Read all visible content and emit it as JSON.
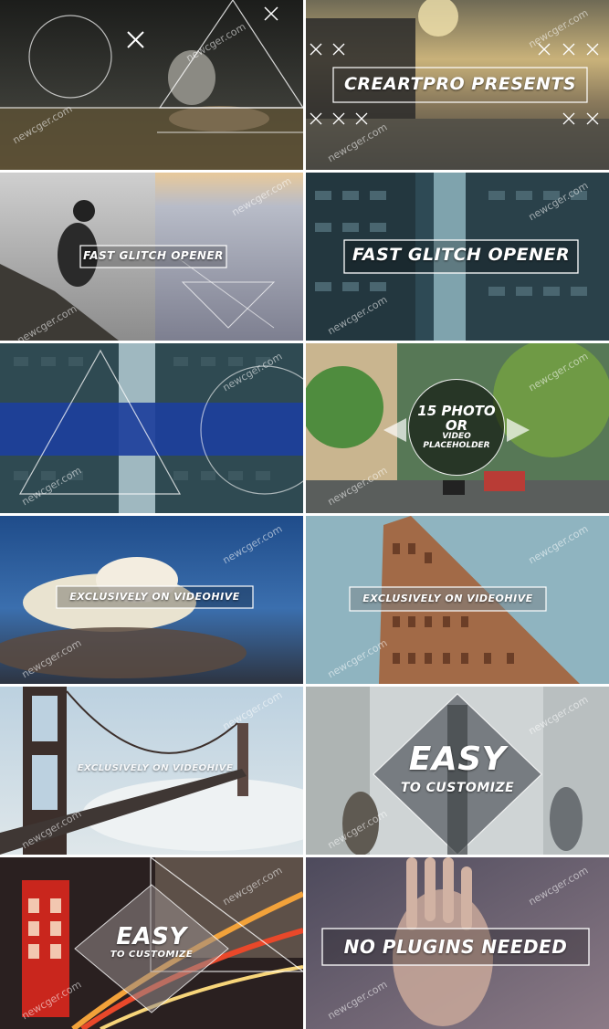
{
  "watermark": "newcger.com",
  "tiles": [
    {
      "id": "t1",
      "caption": ""
    },
    {
      "id": "t2",
      "caption": "CREARTPRO PRESENTS"
    },
    {
      "id": "t3",
      "caption": "FAST GLITCH OPENER"
    },
    {
      "id": "t4",
      "caption": "FAST GLITCH OPENER"
    },
    {
      "id": "t5",
      "caption": ""
    },
    {
      "id": "t6",
      "caption_line1": "15 PHOTO",
      "caption_line2": "OR",
      "caption_line3": "VIDEO",
      "caption_line4": "PLACEHOLDER"
    },
    {
      "id": "t7",
      "caption": "EXCLUSIVELY ON VIDEOHIVE"
    },
    {
      "id": "t8",
      "caption": "EXCLUSIVELY ON VIDEOHIVE"
    },
    {
      "id": "t9",
      "caption": "EXCLUSIVELY ON VIDEOHIVE"
    },
    {
      "id": "t10",
      "caption_big": "EASY",
      "caption_small": "TO CUSTOMIZE"
    },
    {
      "id": "t11",
      "caption_big": "EASY",
      "caption_small": "TO CUSTOMIZE"
    },
    {
      "id": "t12",
      "caption": "NO PLUGINS NEEDED"
    }
  ],
  "colors": {
    "dark_forest": "#2b2c2a",
    "sunset_sky": "#b89a63",
    "clouds_grey": "#9a9ea3",
    "city_teal": "#2e4a55",
    "glitch_blue": "#1d3f9c",
    "street_green": "#3f6b3a",
    "sky_blue": "#2f5f97",
    "bridge_sky": "#a9c4d8",
    "glass_grey": "#c9cfd1",
    "night_red": "#c23a22",
    "rain_purple": "#6a5f78"
  }
}
